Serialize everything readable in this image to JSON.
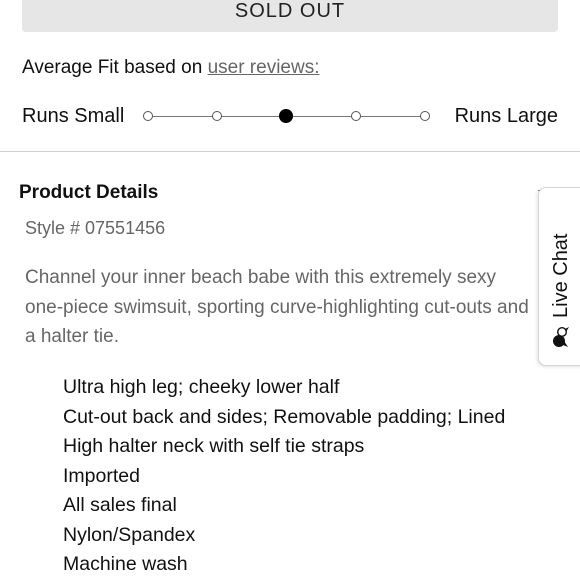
{
  "sold_out_label": "SOLD OUT",
  "fit": {
    "heading": "Average Fit based on",
    "reviews_link": "user reviews:",
    "left_label": "Runs Small",
    "right_label": "Runs Large",
    "selected_index": 2,
    "steps": 5
  },
  "product_details": {
    "title": "Product Details",
    "style_number": "Style # 07551456",
    "description": "Channel your inner beach babe with this extremely sexy one-piece swimsuit, sporting curve-highlighting cut-outs and a halter tie.",
    "features": [
      "Ultra high leg; cheeky lower half",
      "Cut-out back and sides; Removable padding; Lined",
      "High halter neck with self tie straps",
      "Imported",
      "All sales final",
      "Nylon/Spandex",
      "Machine wash"
    ]
  },
  "live_chat": {
    "label": "Live Chat",
    "icon": "chat-bubbles-icon"
  }
}
